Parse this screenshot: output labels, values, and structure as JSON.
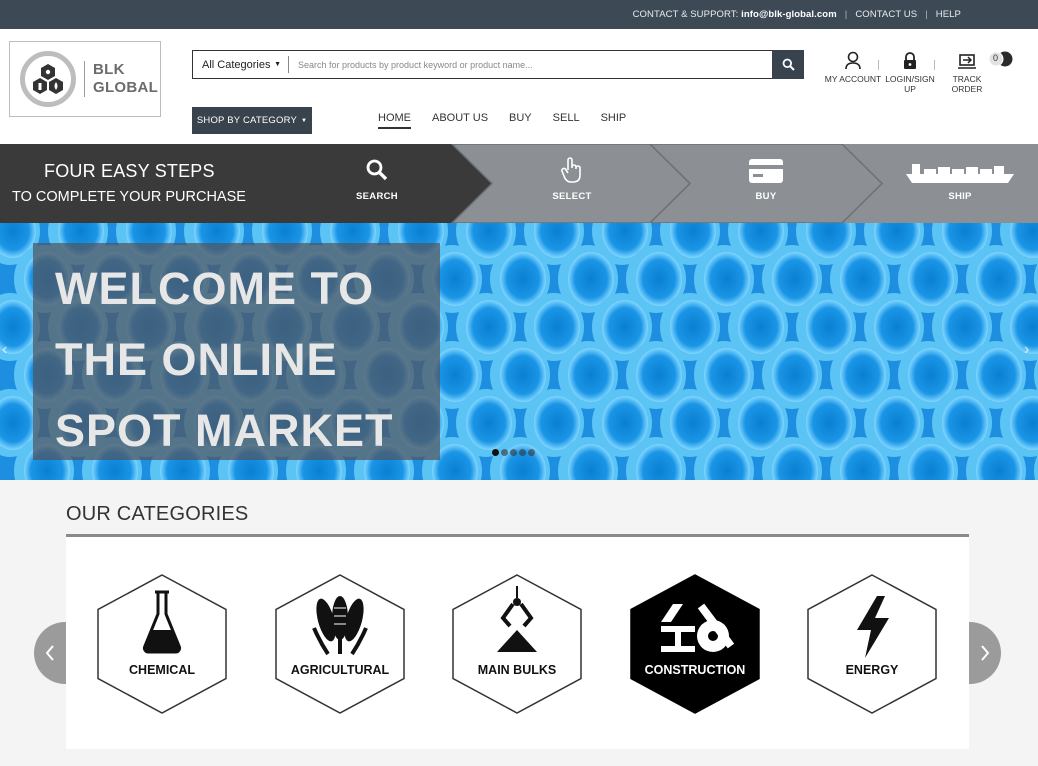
{
  "topbar": {
    "support_label": "CONTACT & SUPPORT:",
    "support_email": "info@blk-global.com",
    "contact_label": "CONTACT US",
    "help_label": "HELP"
  },
  "logo": {
    "line1": "BLK",
    "line2": "GLOBAL"
  },
  "search": {
    "category": "All Categories",
    "placeholder": "Search for products by product keyword or product name...",
    "icon": "search-icon"
  },
  "account": {
    "my_account": "MY ACCOUNT",
    "login_line1": "LOGIN/SIGN",
    "login_line2": "UP",
    "track_line1": "TRACK",
    "track_line2": "ORDER",
    "cart_count": "0"
  },
  "shop_by_category": "SHOP BY CATEGORY",
  "nav": [
    "HOME",
    "ABOUT US",
    "BUY",
    "SELL",
    "SHIP"
  ],
  "steps": {
    "title": "FOUR EASY STEPS",
    "subtitle": "TO COMPLETE YOUR PURCHASE",
    "items": [
      {
        "label": "SEARCH",
        "icon": "search-icon"
      },
      {
        "label": "SELECT",
        "icon": "hand-pointer-icon"
      },
      {
        "label": "BUY",
        "icon": "credit-card-icon"
      },
      {
        "label": "SHIP",
        "icon": "cargo-ship-icon"
      }
    ]
  },
  "banner": {
    "lines": [
      "WELCOME TO",
      "THE ONLINE",
      "SPOT MARKET"
    ],
    "slide_count": 5,
    "active_slide": 1
  },
  "categories": {
    "title": "OUR CATEGORIES",
    "items": [
      {
        "label": "CHEMICAL",
        "icon": "flask-icon"
      },
      {
        "label": "AGRICULTURAL",
        "icon": "corn-icon"
      },
      {
        "label": "MAIN BULKS",
        "icon": "grab-crane-icon"
      },
      {
        "label": "CONSTRUCTION",
        "icon": "steel-beam-icon",
        "highlighted": true
      },
      {
        "label": "ENERGY",
        "icon": "lightning-icon"
      }
    ]
  },
  "colors": {
    "topbar": "#3d4a56",
    "dark_button": "#39434d",
    "steps_dark": "#3a3a3a",
    "steps_light": "#8c9094",
    "banner_blue": "#2aa6ef"
  }
}
